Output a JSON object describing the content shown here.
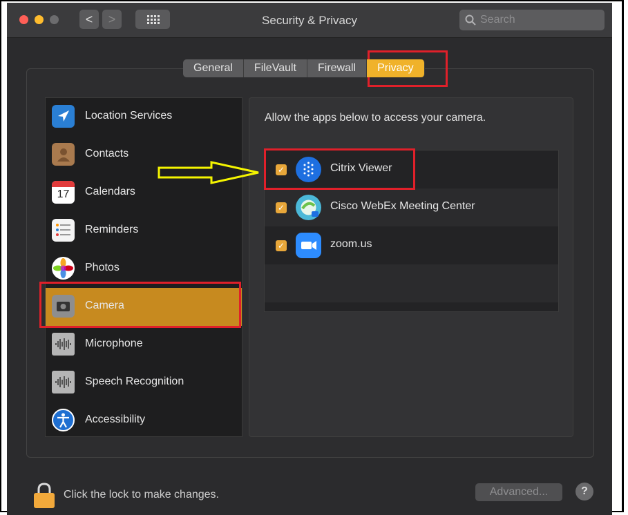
{
  "window": {
    "title": "Security & Privacy",
    "search_placeholder": "Search",
    "nav_back": "<",
    "nav_forward": ">"
  },
  "tabs": [
    {
      "label": "General",
      "selected": false
    },
    {
      "label": "FileVault",
      "selected": false
    },
    {
      "label": "Firewall",
      "selected": false
    },
    {
      "label": "Privacy",
      "selected": true
    }
  ],
  "sidebar": {
    "items": [
      {
        "label": "Location Services",
        "icon": "location-arrow-icon",
        "selected": false
      },
      {
        "label": "Contacts",
        "icon": "contacts-book-icon",
        "selected": false
      },
      {
        "label": "Calendars",
        "icon": "calendar-icon",
        "selected": false,
        "icon_text": "17"
      },
      {
        "label": "Reminders",
        "icon": "reminders-list-icon",
        "selected": false
      },
      {
        "label": "Photos",
        "icon": "photos-flower-icon",
        "selected": false
      },
      {
        "label": "Camera",
        "icon": "camera-icon",
        "selected": true
      },
      {
        "label": "Microphone",
        "icon": "microphone-waveform-icon",
        "selected": false
      },
      {
        "label": "Speech Recognition",
        "icon": "speech-waveform-icon",
        "selected": false
      },
      {
        "label": "Accessibility",
        "icon": "accessibility-person-icon",
        "selected": false
      }
    ]
  },
  "main": {
    "instruction": "Allow the apps below to access your camera.",
    "apps": [
      {
        "name": "Citrix Viewer",
        "checked": true,
        "icon": "citrix-viewer-icon"
      },
      {
        "name": "Cisco WebEx Meeting Center",
        "checked": true,
        "icon": "cisco-webex-icon"
      },
      {
        "name": "zoom.us",
        "checked": true,
        "icon": "zoom-icon"
      }
    ]
  },
  "footer": {
    "lock_text": "Click the lock to make changes.",
    "advanced_label": "Advanced...",
    "help_label": "?"
  },
  "colors": {
    "accent": "#f0b22a",
    "selected_row": "#c78a1f",
    "highlight_box": "#e0202a",
    "annotation_arrow": "#f5f500"
  }
}
